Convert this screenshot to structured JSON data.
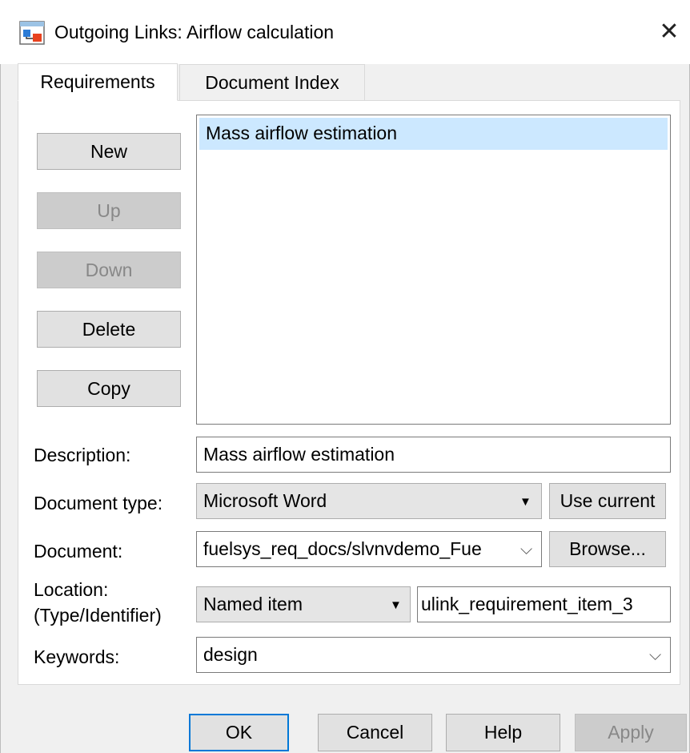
{
  "window": {
    "title": "Outgoing Links: Airflow calculation",
    "close_glyph": "✕"
  },
  "tabs": [
    {
      "label": "Requirements"
    },
    {
      "label": "Document Index"
    }
  ],
  "side_buttons": {
    "new": "New",
    "up": "Up",
    "down": "Down",
    "delete": "Delete",
    "copy": "Copy"
  },
  "requirements_list": {
    "items": [
      "Mass airflow estimation"
    ],
    "selected_index": 0
  },
  "form": {
    "description_label": "Description:",
    "description_value": "Mass airflow estimation",
    "doctype_label": "Document type:",
    "doctype_value": "Microsoft Word",
    "use_current_label": "Use current",
    "document_label": "Document:",
    "document_value": "fuelsys_req_docs/slvnvdemo_Fue",
    "browse_label": "Browse...",
    "location_label_1": "Location:",
    "location_label_2": "(Type/Identifier)",
    "location_type_value": "Named item",
    "location_id_value": "ulink_requirement_item_3",
    "keywords_label": "Keywords:",
    "keywords_value": "design"
  },
  "footer": {
    "ok": "OK",
    "cancel": "Cancel",
    "help": "Help",
    "apply": "Apply"
  },
  "icons": {
    "app": "simulink-model-icon",
    "close": "close-icon",
    "dropdown": "caret-down-icon",
    "combo_chevron": "chevron-down-icon"
  },
  "colors": {
    "selection": "#cce8ff",
    "focus_border": "#0078d7",
    "disabled_text": "#888888"
  }
}
